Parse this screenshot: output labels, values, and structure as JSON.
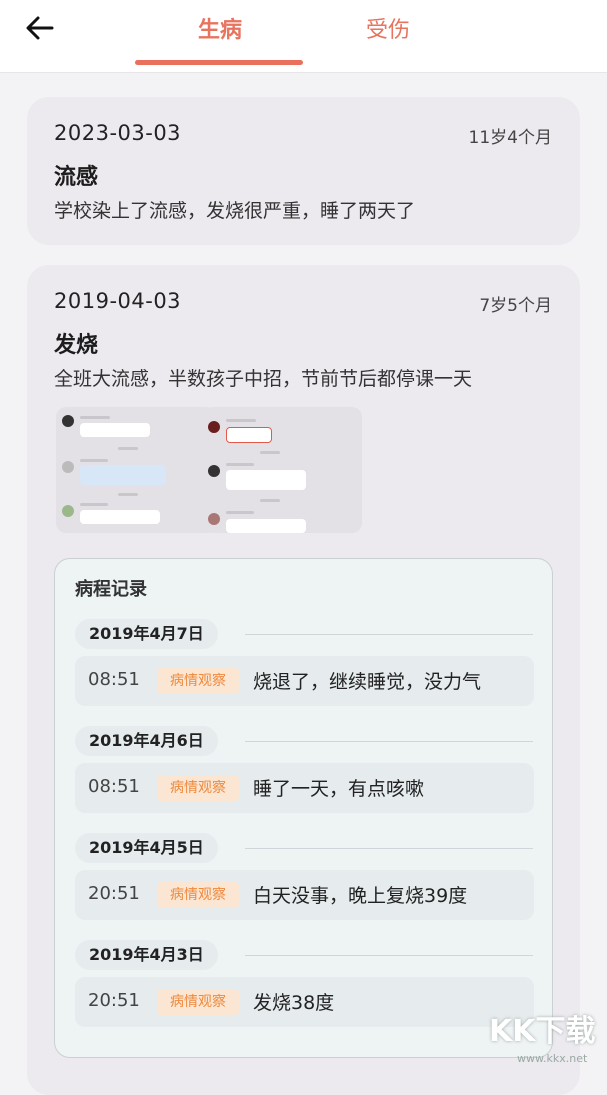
{
  "header": {
    "tabs": [
      {
        "label": "生病",
        "active": true
      },
      {
        "label": "受伤",
        "active": false
      }
    ],
    "accent_color": "#ea6f5d"
  },
  "records": [
    {
      "date": "2023-03-03",
      "age": "11岁4个月",
      "title": "流感",
      "description": "学校染上了流感，发烧很严重，睡了两天了"
    },
    {
      "date": "2019-04-03",
      "age": "7岁5个月",
      "title": "发烧",
      "description": "全班大流感，半数孩子中招，节前节后都停课一天",
      "attachments": [
        "chat-screenshot",
        "chat-screenshot"
      ],
      "course": {
        "title": "病程记录",
        "days": [
          {
            "date": "2019年4月7日",
            "entries": [
              {
                "time": "08:51",
                "tag": "病情观察",
                "text": "烧退了，继续睡觉，没力气"
              }
            ]
          },
          {
            "date": "2019年4月6日",
            "entries": [
              {
                "time": "08:51",
                "tag": "病情观察",
                "text": "睡了一天，有点咳嗽"
              }
            ]
          },
          {
            "date": "2019年4月5日",
            "entries": [
              {
                "time": "20:51",
                "tag": "病情观察",
                "text": "白天没事，晚上复烧39度"
              }
            ]
          },
          {
            "date": "2019年4月3日",
            "entries": [
              {
                "time": "20:51",
                "tag": "病情观察",
                "text": "发烧38度"
              }
            ]
          }
        ]
      }
    }
  ],
  "watermark": {
    "text": "KK下载",
    "url": "www.kkx.net"
  }
}
